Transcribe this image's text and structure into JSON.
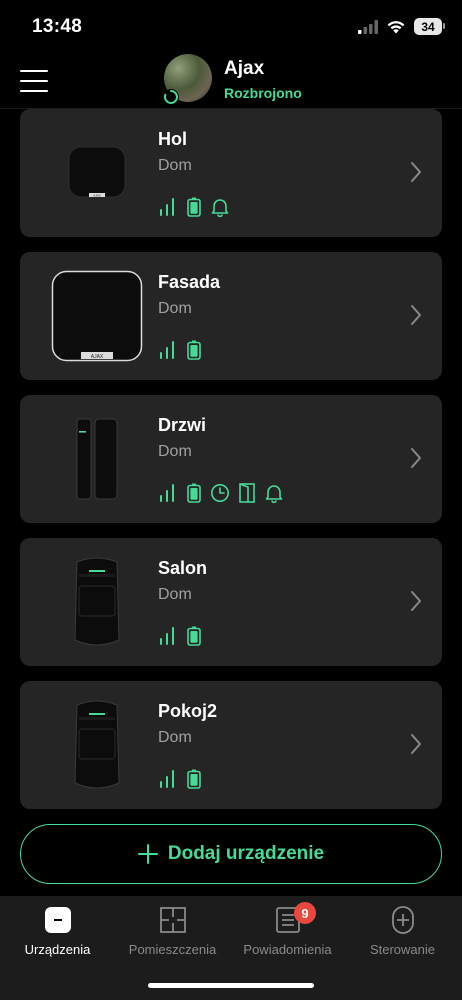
{
  "status_bar": {
    "time": "13:48",
    "battery": "34"
  },
  "header": {
    "hub_name": "Ajax",
    "hub_status": "Rozbrojono"
  },
  "devices": [
    {
      "name": "Hol",
      "room": "Dom"
    },
    {
      "name": "Fasada",
      "room": "Dom"
    },
    {
      "name": "Drzwi",
      "room": "Dom"
    },
    {
      "name": "Salon",
      "room": "Dom"
    },
    {
      "name": "Pokoj2",
      "room": "Dom"
    }
  ],
  "device_logo": "AJAX",
  "add_button": {
    "label": "Dodaj urządzenie"
  },
  "tabs": [
    {
      "label": "Urządzenia",
      "active": true
    },
    {
      "label": "Pomieszczenia",
      "active": false
    },
    {
      "label": "Powiadomienia",
      "active": false,
      "badge": "9"
    },
    {
      "label": "Sterowanie",
      "active": false
    }
  ],
  "colors": {
    "accent": "#47d996",
    "card": "#252525",
    "badge": "#e8483d"
  }
}
